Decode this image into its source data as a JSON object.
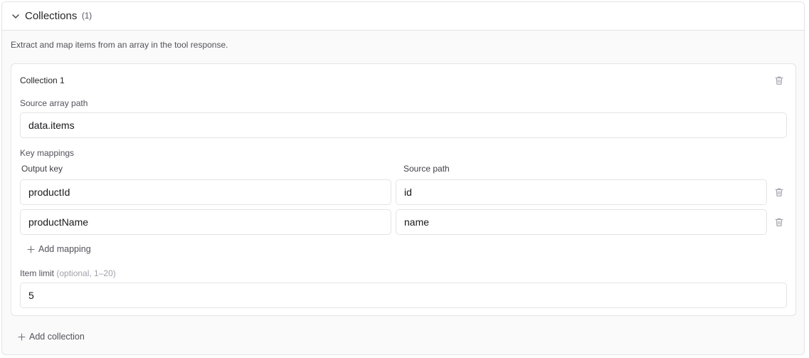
{
  "section": {
    "title": "Collections",
    "count": "(1)",
    "description": "Extract and map items from an array in the tool response."
  },
  "collection": {
    "title": "Collection 1",
    "source_array_label": "Source array path",
    "source_array_value": "data.items",
    "key_mappings_label": "Key mappings",
    "output_key_header": "Output key",
    "source_path_header": "Source path",
    "mappings": [
      {
        "output_key": "productId",
        "source_path": "id"
      },
      {
        "output_key": "productName",
        "source_path": "name"
      }
    ],
    "add_mapping_label": "Add mapping",
    "item_limit_label": "Item limit",
    "item_limit_hint": "(optional, 1–20)",
    "item_limit_value": "5"
  },
  "footer": {
    "add_collection_label": "Add collection"
  },
  "icons": {
    "collapse": "chevron-down-icon",
    "delete": "trash-icon",
    "add": "plus-icon"
  },
  "colors": {
    "border": "#e4e4e7",
    "panel_bg": "#fafafa",
    "muted_text": "#52525b",
    "icon": "#a1a1aa"
  }
}
